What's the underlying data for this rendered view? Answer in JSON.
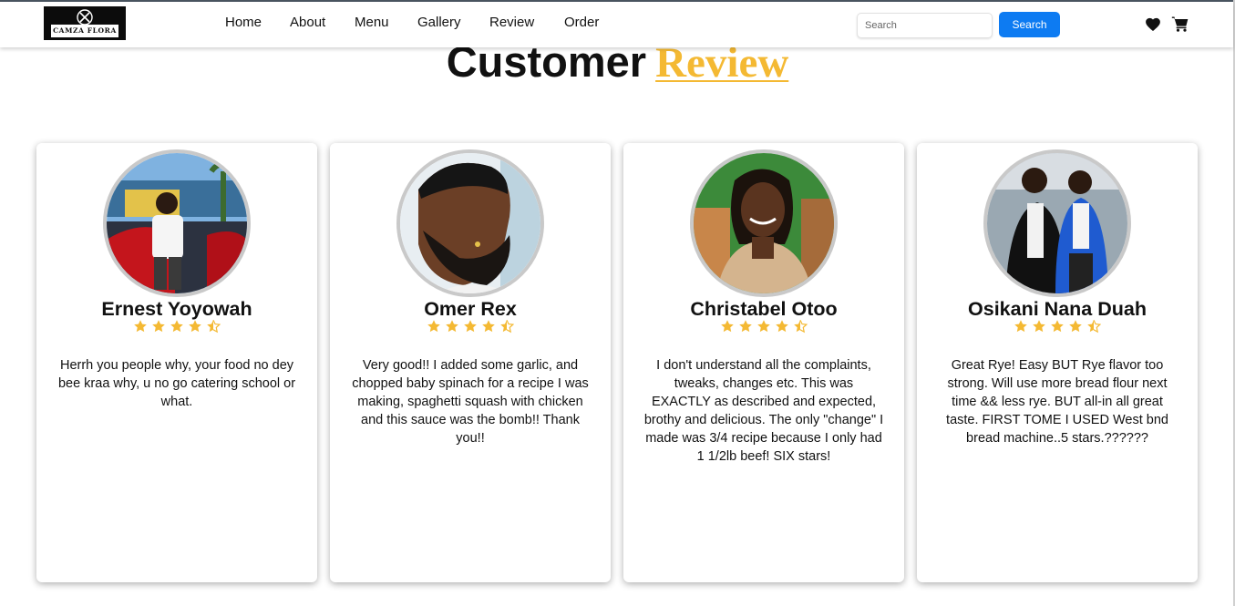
{
  "brand": {
    "logo_text": "CAMZA FLORA"
  },
  "nav": {
    "items": [
      {
        "label": "Home"
      },
      {
        "label": "About"
      },
      {
        "label": "Menu"
      },
      {
        "label": "Gallery"
      },
      {
        "label": "Review"
      },
      {
        "label": "Order"
      }
    ]
  },
  "search": {
    "placeholder": "Search",
    "button_label": "Search"
  },
  "header_icons": [
    "heart-icon",
    "cart-icon"
  ],
  "section": {
    "title_part1": "Customer",
    "title_part2": "Review"
  },
  "colors": {
    "accent": "#f4b933",
    "button": "#0d7bf2",
    "star": "#f4b933"
  },
  "reviews": [
    {
      "name": "Ernest Yoyowah",
      "rating": 4.5,
      "text": "Herrh you people why, your food no dey bee kraa why, u no go catering school or what."
    },
    {
      "name": "Omer Rex",
      "rating": 4.5,
      "text": "Very good!! I added some garlic, and chopped baby spinach for a recipe I was making, spaghetti squash with chicken and this sauce was the bomb!! Thank you!!"
    },
    {
      "name": "Christabel Otoo",
      "rating": 4.5,
      "text": "I don't understand all the complaints, tweaks, changes etc. This was EXACTLY as described and expected, brothy and delicious. The only \"change\" I made was 3/4 recipe because I only had 1 1/2lb beef! SIX stars!"
    },
    {
      "name": "Osikani Nana Duah",
      "rating": 4.5,
      "text": "Great Rye! Easy BUT Rye flavor too strong. Will use more bread flour next time && less rye. BUT all-in all great taste. FIRST TOME I USED West bnd bread machine..5 stars.??????"
    }
  ]
}
